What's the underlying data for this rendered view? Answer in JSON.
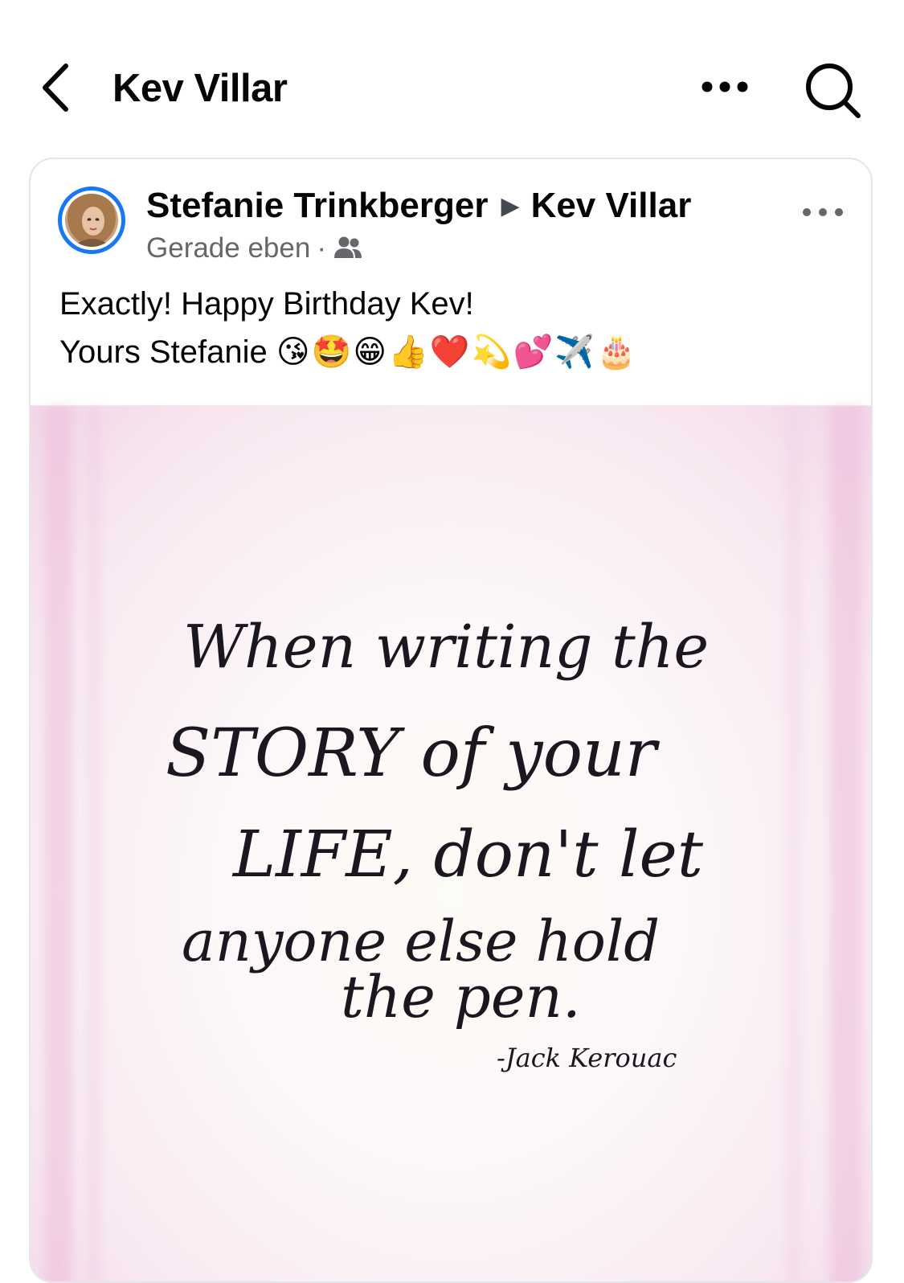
{
  "header": {
    "title": "Kev Villar",
    "back_icon": "chevron-left-icon",
    "more_icon": "more-horizontal-icon",
    "search_icon": "search-icon"
  },
  "post": {
    "author": "Stefanie Trinkberger",
    "target": "Kev Villar",
    "timestamp": "Gerade eben",
    "audience_icon": "friends-icon",
    "text_line1": "Exactly! Happy Birthday Kev!",
    "text_line2": "Yours Stefanie",
    "emojis": "😘🤩😁👍❤️💫💕✈️🎂",
    "image": {
      "quote_lines": [
        "When writing the",
        "STORY of your",
        "LIFE, don't let",
        "anyone else hold",
        "the pen."
      ],
      "attribution": "-Jack Kerouac"
    }
  },
  "colors": {
    "accent": "#1877f2",
    "secondary_text": "#65676b",
    "primary_text": "#050505",
    "card_border": "#e4e6eb",
    "image_bg": "#f8e9f1"
  }
}
